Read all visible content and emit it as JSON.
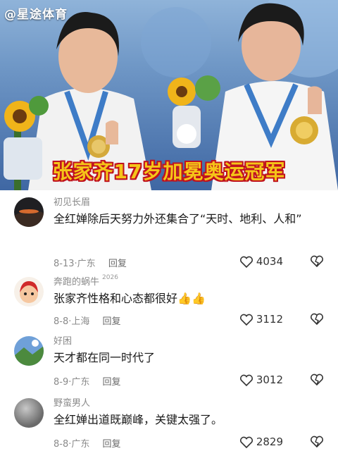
{
  "watermark": "@星途体育",
  "headline": "张家齐17岁加冕奥运冠军",
  "comments": [
    {
      "user": "初见长眉",
      "tag": "",
      "text": "全红婵除后天努力外还集合了“天时、地利、人和”",
      "date": "8-13",
      "location": "广东",
      "reply_label": "回复",
      "likes": "4034",
      "avatar_icon": "sunset-avatar-icon"
    },
    {
      "user": "奔跑的蜗牛",
      "tag": "2026",
      "text": "张家齐性格和心态都很好",
      "emoji": "👍👍",
      "date": "8-8",
      "location": "上海",
      "reply_label": "回复",
      "likes": "3112",
      "avatar_icon": "cartoon-avatar-icon"
    },
    {
      "user": "好困",
      "tag": "",
      "text": "天才都在同一时代了",
      "date": "8-9",
      "location": "广东",
      "reply_label": "回复",
      "likes": "3012",
      "avatar_icon": "landscape-avatar-icon"
    },
    {
      "user": "野蛮男人",
      "tag": "",
      "text": "全红婵出道既巅峰，关键太强了。",
      "date": "8-8",
      "location": "广东",
      "reply_label": "回复",
      "likes": "2829",
      "avatar_icon": "gray-avatar-icon"
    }
  ],
  "colors": {
    "headline": "#f5c518",
    "headline_outline": "#c0121e",
    "meta": "#8a8a8a"
  }
}
